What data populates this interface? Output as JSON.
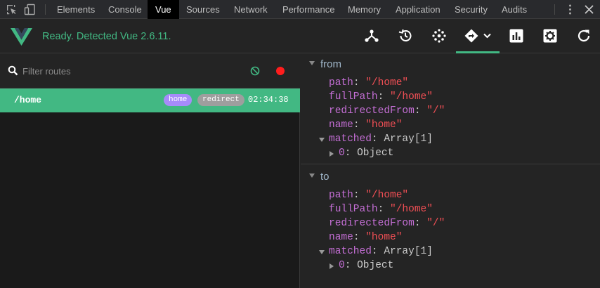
{
  "devtools": {
    "tabs": [
      "Elements",
      "Console",
      "Vue",
      "Sources",
      "Network",
      "Performance",
      "Memory",
      "Application",
      "Security",
      "Audits"
    ],
    "active_tab": "Vue"
  },
  "vue": {
    "status": "Ready. Detected Vue 2.6.11.",
    "brand_color": "#42b883",
    "header_icons": [
      "components-icon",
      "history-icon",
      "vuex-icon",
      "routing-icon",
      "performance-icon",
      "settings-icon",
      "refresh-icon"
    ]
  },
  "routes": {
    "filter_placeholder": "Filter routes",
    "items": [
      {
        "path": "/home",
        "tags": [
          "home",
          "redirect"
        ],
        "time": "02:34:38"
      }
    ]
  },
  "inspector": {
    "from": {
      "title": "from",
      "path_key": "path",
      "path": "\"/home\"",
      "fullPath_key": "fullPath",
      "fullPath": "\"/home\"",
      "redirectedFrom_key": "redirectedFrom",
      "redirectedFrom": "\"/\"",
      "name_key": "name",
      "name": "\"home\"",
      "matched_key": "matched",
      "matched": "Array[1]",
      "matched_item_key": "0",
      "matched_item": "Object"
    },
    "to": {
      "title": "to",
      "path_key": "path",
      "path": "\"/home\"",
      "fullPath_key": "fullPath",
      "fullPath": "\"/home\"",
      "redirectedFrom_key": "redirectedFrom",
      "redirectedFrom": "\"/\"",
      "name_key": "name",
      "name": "\"home\"",
      "matched_key": "matched",
      "matched": "Array[1]",
      "matched_item_key": "0",
      "matched_item": "Object"
    }
  }
}
